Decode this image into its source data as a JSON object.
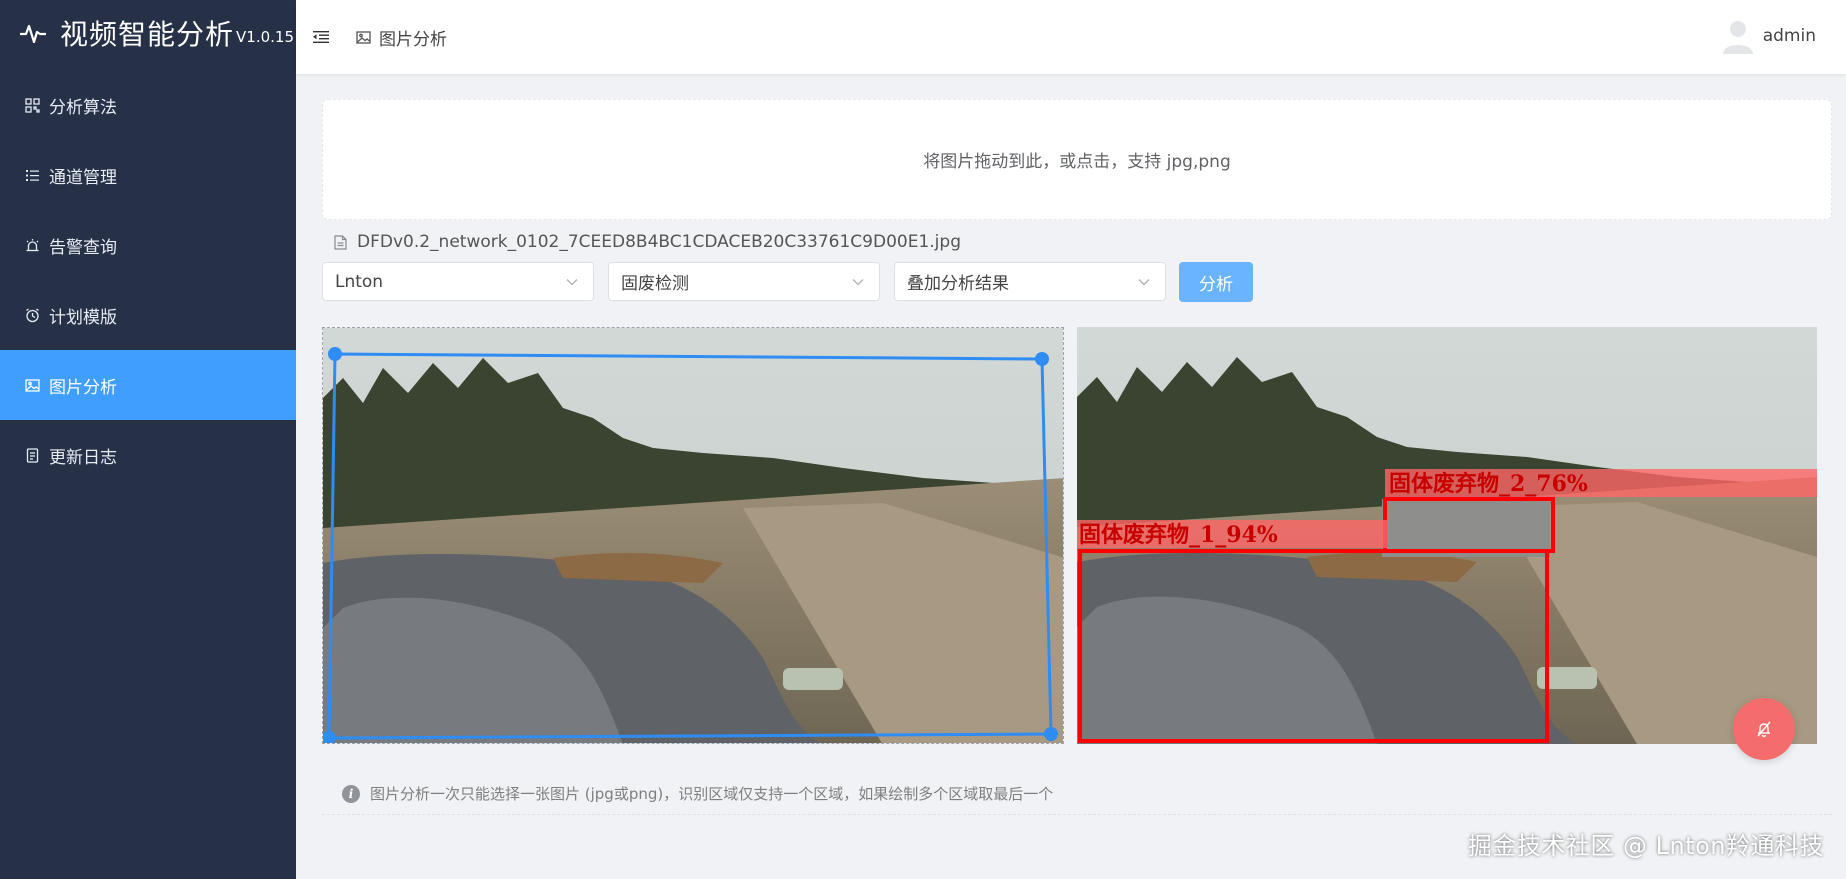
{
  "app": {
    "title": "视频智能分析",
    "version": "V1.0.15"
  },
  "sidebar": {
    "items": [
      {
        "label": "分析算法",
        "icon": "grid-icon"
      },
      {
        "label": "通道管理",
        "icon": "list-icon"
      },
      {
        "label": "告警查询",
        "icon": "alarm-icon"
      },
      {
        "label": "计划模版",
        "icon": "clock-icon"
      },
      {
        "label": "图片分析",
        "icon": "image-icon",
        "active": true
      },
      {
        "label": "更新日志",
        "icon": "document-icon"
      }
    ]
  },
  "header": {
    "breadcrumb": "图片分析",
    "user": "admin"
  },
  "upload": {
    "text": "将图片拖动到此，或点击，支持 jpg,png"
  },
  "file": {
    "name": "DFDv0.2_network_0102_7CEED8B4BC1CDACEB20C33761C9D00E1.jpg"
  },
  "controls": {
    "select1": "Lnton",
    "select2": "固废检测",
    "select3": "叠加分析结果",
    "analyze_label": "分析"
  },
  "results": {
    "det1": "固体废弃物_1_94%",
    "det2": "固体废弃物_2_76%"
  },
  "hint": {
    "text": "图片分析一次只能选择一张图片 (jpg或png)，识别区域仅支持一个区域，如果绘制多个区域取最后一个"
  },
  "watermark": "掘金技术社区 @ Lnton羚通科技",
  "colors": {
    "sidebar": "#263148",
    "accent": "#409eff",
    "detection": "#ff0000",
    "fab": "#f56c6c"
  }
}
